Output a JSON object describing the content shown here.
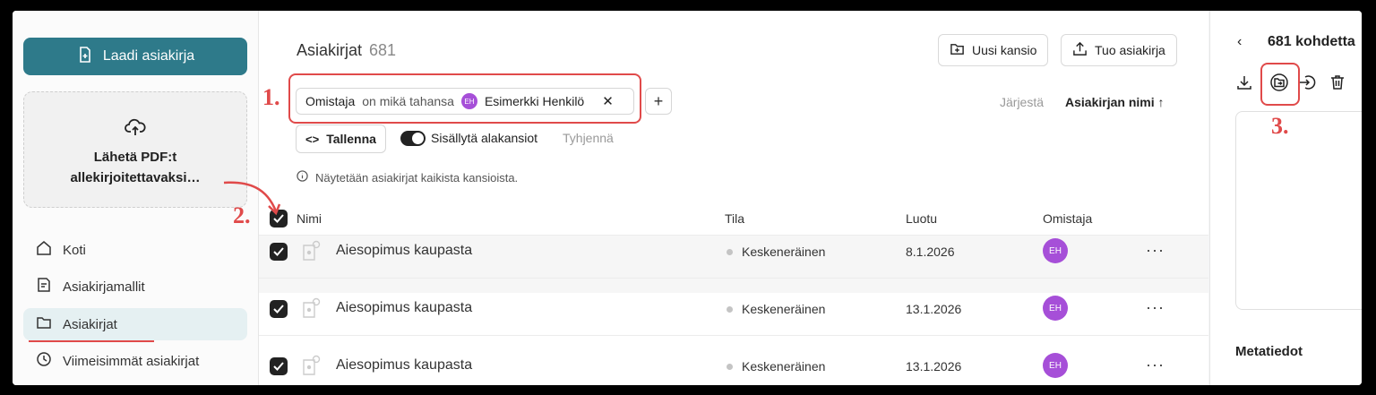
{
  "sidebar": {
    "create_label": "Laadi asiakirja",
    "upload_line1": "Lähetä PDF:t",
    "upload_line2": "allekirjoitettavaksi…",
    "items": [
      {
        "label": "Koti",
        "icon": "home-icon"
      },
      {
        "label": "Asiakirjamallit",
        "icon": "template-icon"
      },
      {
        "label": "Asiakirjat",
        "icon": "folder-icon",
        "active": true
      },
      {
        "label": "Viimeisimmät asiakirjat",
        "icon": "clock-icon"
      }
    ]
  },
  "main": {
    "title": "Asiakirjat",
    "count": "681",
    "new_folder_label": "Uusi kansio",
    "import_label": "Tuo asiakirja",
    "filter": {
      "field": "Omistaja",
      "operator": "on mikä tahansa",
      "avatar_initials": "EH",
      "value": "Esimerkki Henkilö"
    },
    "add_filter_label": "+",
    "save_label": "Tallenna",
    "include_subfolders_label": "Sisällytä alakansiot",
    "clear_label": "Tyhjennä",
    "sort_label": "Järjestä",
    "sort_value": "Asiakirjan nimi ↑",
    "info_text": "Näytetään asiakirjat kaikista kansioista.",
    "columns": {
      "name": "Nimi",
      "status": "Tila",
      "created": "Luotu",
      "owner": "Omistaja"
    },
    "rows": [
      {
        "name": "Aiesopimus kaupasta",
        "status": "Keskeneräinen",
        "date": "8.1.2026",
        "owner": "EH"
      },
      {
        "name": "Aiesopimus kaupasta",
        "status": "Keskeneräinen",
        "date": "13.1.2026",
        "owner": "EH"
      },
      {
        "name": "Aiesopimus kaupasta",
        "status": "Keskeneräinen",
        "date": "13.1.2026",
        "owner": "EH"
      }
    ],
    "more_label": "···"
  },
  "right_panel": {
    "back_label": "‹",
    "selection_title": "681 kohdetta",
    "metadata_label": "Metatiedot"
  },
  "annotations": {
    "one": "1.",
    "two": "2.",
    "three": "3."
  },
  "colors": {
    "accent": "#2e7a8a",
    "annotation": "#e04a4a",
    "avatar": "#a64fd8"
  }
}
